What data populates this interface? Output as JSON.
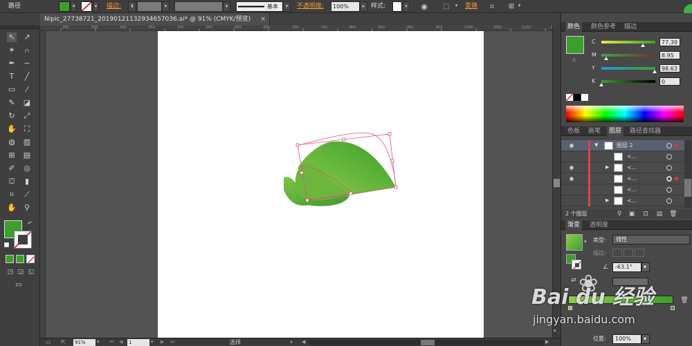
{
  "control_bar": {
    "selection_type": "路径",
    "stroke_label": "描边:",
    "brush_label": "基本",
    "opacity_label": "不透明度:",
    "opacity_value": "100%",
    "style_label": "样式:",
    "transform_label": "变换"
  },
  "document": {
    "tab_title": "Nipic_27738721_20190121132934657036.ai* @ 91% (CMYK/预览)",
    "close_glyph": "×"
  },
  "rulers": {
    "h_ticks": [
      "295",
      "348",
      "400",
      "450",
      "500",
      "550",
      "600",
      "650",
      "700",
      "750",
      "800",
      "850",
      "900",
      "950",
      "1000",
      "1052",
      "1102",
      "1152"
    ]
  },
  "colors": {
    "fill": "#3c9f2c",
    "stroke": "none",
    "selection": "#e0507a",
    "accent_badge": "#3db04a"
  },
  "color_panel": {
    "tabs": [
      "颜色",
      "颜色参考",
      "描边"
    ],
    "channels": [
      {
        "label": "C",
        "value": "77.39",
        "level": 0.77
      },
      {
        "label": "M",
        "value": "8.95",
        "level": 0.09
      },
      {
        "label": "Y",
        "value": "98.63",
        "level": 0.99
      },
      {
        "label": "K",
        "value": "0",
        "level": 0
      }
    ]
  },
  "layers_panel": {
    "tabs": [
      "色板",
      "画笔",
      "图层",
      "路径查找器"
    ],
    "active_tab": 2,
    "top_layer": "图层 2",
    "sublayers": [
      "<...",
      "<...",
      "<...",
      "<...",
      "<..."
    ],
    "footer": "2 个图层"
  },
  "gradient_panel": {
    "tabs": [
      "渐变",
      "透明度"
    ],
    "type_label": "类型:",
    "type_value": "线性",
    "stroke_label": "描边:",
    "angle_value": "-63.1°",
    "position_label": "位置:",
    "position_value": "100%"
  },
  "status_bar": {
    "zoom": "91%",
    "page": "1",
    "mode": "选择"
  },
  "watermark": {
    "brand": "Bai du 经验",
    "url": "jingyan.baidu.com"
  }
}
